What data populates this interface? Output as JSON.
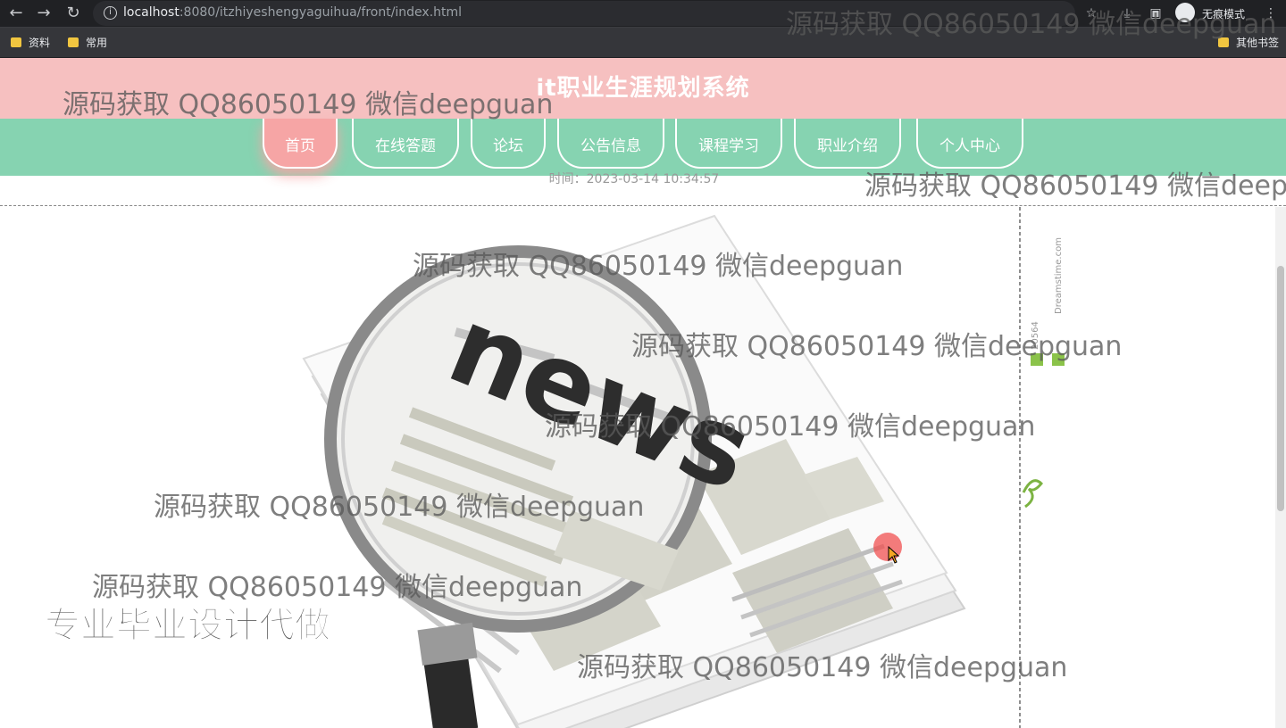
{
  "browser": {
    "url_host": "localhost",
    "url_path": ":8080/itzhiyeshengyaguihua/front/index.html",
    "incognito_label": "无痕模式",
    "bookmarks": [
      "资料",
      "常用"
    ],
    "other_bookmarks": "其他书签"
  },
  "site": {
    "title": "it职业生涯规划系统",
    "nav": [
      "首页",
      "在线答题",
      "论坛",
      "公告信息",
      "课程学习",
      "职业介绍",
      "个人中心"
    ],
    "time_text": "时间：2023-03-14 10:34:57"
  },
  "banner": {
    "headline": "news",
    "side_credit": "Dreamstime.com",
    "side_id": "20564"
  },
  "watermark": "源码获取 QQ86050149 微信deepguan",
  "promo": "专业毕业设计代做",
  "colors": {
    "header": "#f6c0c0",
    "nav": "#86d3b1",
    "nav_active": "#f6a5a5"
  },
  "icons": [
    "back-icon",
    "forward-icon",
    "reload-icon",
    "info-icon",
    "star-icon",
    "download-icon",
    "sidebar-icon",
    "incognito-icon",
    "menu-icon",
    "folder-icon",
    "cursor-icon"
  ]
}
